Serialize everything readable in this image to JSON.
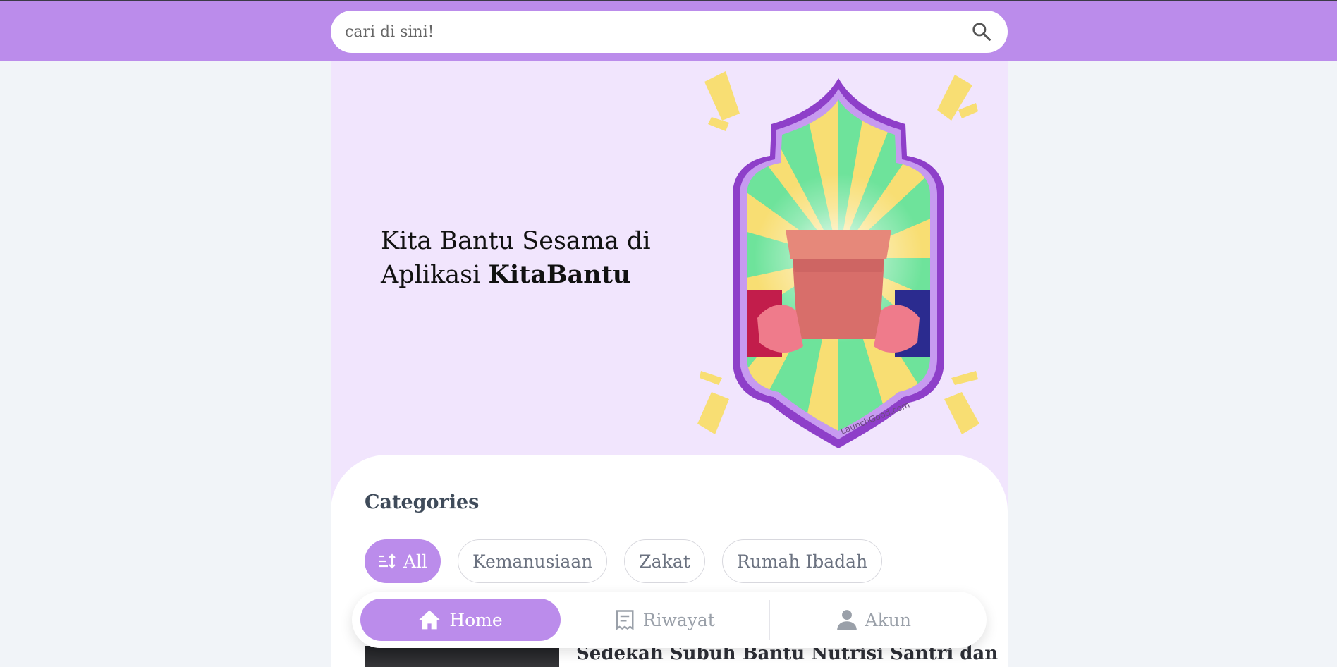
{
  "search": {
    "placeholder": "cari di sini!"
  },
  "hero": {
    "headline_part1": "Kita Bantu Sesama di",
    "headline_part2": "Aplikasi ",
    "headline_brand": "KitaBantu",
    "illustration_watermark": "LaunchGood.com"
  },
  "categories": {
    "title": "Categories",
    "items": [
      {
        "label": "All",
        "active": true,
        "icon": "sort-icon"
      },
      {
        "label": "Kemanusiaan",
        "active": false
      },
      {
        "label": "Zakat",
        "active": false
      },
      {
        "label": "Rumah Ibadah",
        "active": false
      }
    ]
  },
  "article": {
    "title": "Sedekah Subuh Bantu Nutrisi Santri dan"
  },
  "bottom_nav": {
    "items": [
      {
        "label": "Home",
        "icon": "home-icon",
        "active": true
      },
      {
        "label": "Riwayat",
        "icon": "receipt-icon",
        "active": false
      },
      {
        "label": "Akun",
        "icon": "person-icon",
        "active": false
      }
    ]
  },
  "colors": {
    "accent": "#bb8ceb",
    "hero_bg": "#f1e5fd",
    "page_bg": "#f1f4f8"
  }
}
